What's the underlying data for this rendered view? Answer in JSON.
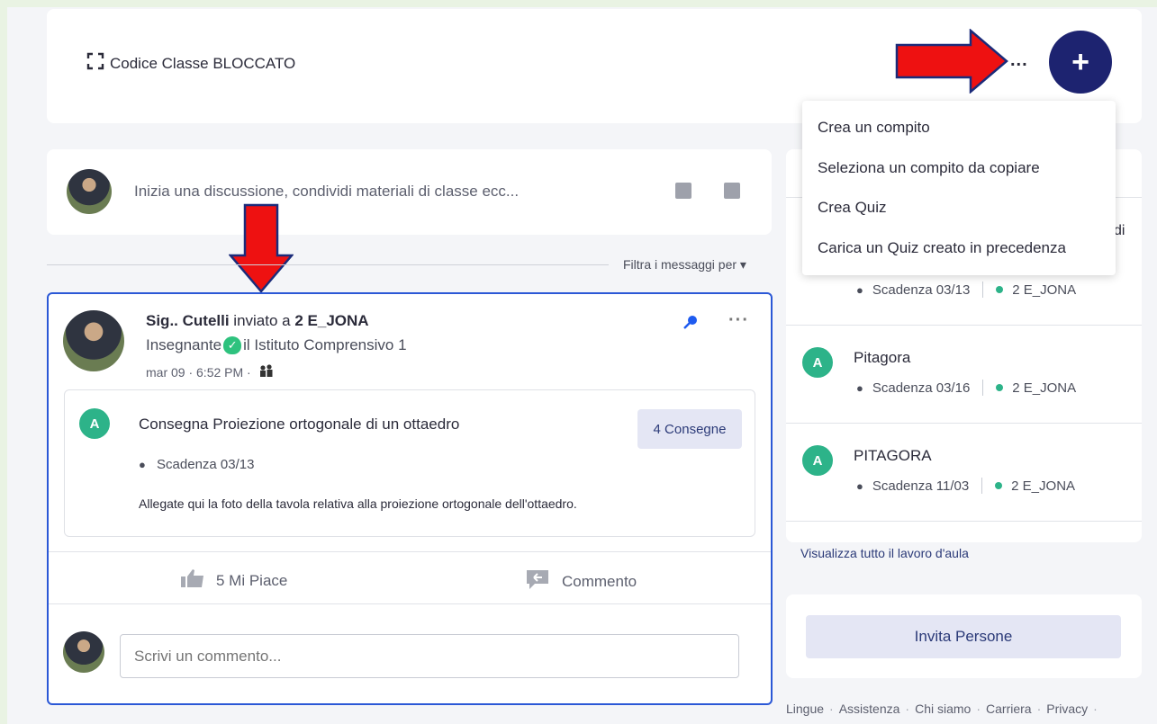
{
  "header": {
    "class_code_label": "Codice Classe BLOCCATO",
    "more_label": "...",
    "add_label": "+"
  },
  "dropdown": {
    "items": [
      "Crea un compito",
      "Seleziona un compito da copiare",
      "Crea Quiz",
      "Carica un Quiz creato in precedenza"
    ]
  },
  "composer": {
    "placeholder": "Inizia una discussione, condividi materiali di classe ecc..."
  },
  "filter": {
    "label": "Filtra i messaggi per ▾"
  },
  "post": {
    "author": "Sig.. Cutelli",
    "sent_to": "inviato a",
    "group": "2 E_JONA",
    "role": "Insegnante",
    "school": "il Istituto Comprensivo 1",
    "time": "mar 09 · 6:52 PM ·",
    "more_label": "···",
    "assignment": {
      "icon_letter": "A",
      "title": "Consegna Proiezione ortogonale di un ottaedro",
      "submissions": "4 Consegne",
      "due": "Scadenza 03/13",
      "description": "Allegate qui la foto della tavola relativa alla proiezione ortogonale dell'ottaedro."
    },
    "like_label": "5 Mi Piace",
    "comment_label": "Commento",
    "comment_placeholder": "Scrivi un commento..."
  },
  "sidebar": {
    "partial_text": "di",
    "items": [
      {
        "title": "",
        "due": "Scadenza 03/13",
        "group": "2 E_JONA"
      },
      {
        "title": "Pitagora",
        "due": "Scadenza 03/16",
        "group": "2 E_JONA"
      },
      {
        "title": "PITAGORA",
        "due": "Scadenza 11/03",
        "group": "2 E_JONA"
      }
    ],
    "view_all": "Visualizza tutto il lavoro d'aula",
    "invite": "Invita Persone"
  },
  "footer": [
    "Lingue",
    "Assistenza",
    "Chi siamo",
    "Carriera",
    "Privacy"
  ],
  "colors": {
    "brand_navy": "#1d2370",
    "accent_green": "#2db389",
    "post_border": "#2b58d6",
    "annotation_red": "#ee1111"
  }
}
